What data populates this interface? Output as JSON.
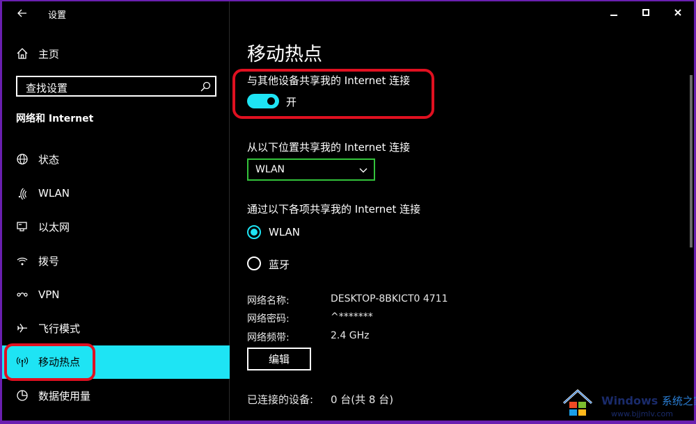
{
  "titlebar": {
    "app_title": "设置"
  },
  "sidebar": {
    "home_label": "主页",
    "search_placeholder": "查找设置",
    "section_title": "网络和 Internet",
    "items": [
      {
        "label": "状态",
        "icon": "globe-icon"
      },
      {
        "label": "WLAN",
        "icon": "wifi-icon"
      },
      {
        "label": "以太网",
        "icon": "ethernet-icon"
      },
      {
        "label": "拨号",
        "icon": "dialup-icon"
      },
      {
        "label": "VPN",
        "icon": "vpn-icon"
      },
      {
        "label": "飞行模式",
        "icon": "airplane-icon"
      },
      {
        "label": "移动热点",
        "icon": "hotspot-icon",
        "selected": true
      },
      {
        "label": "数据使用量",
        "icon": "data-usage-icon"
      }
    ]
  },
  "main": {
    "page_title": "移动热点",
    "share_label": "与其他设备共享我的 Internet 连接",
    "toggle_state": "开",
    "toggle_on": true,
    "from_label": "从以下位置共享我的 Internet 连接",
    "from_selected": "WLAN",
    "via_label": "通过以下各项共享我的 Internet 连接",
    "via_options": [
      {
        "label": "WLAN",
        "checked": true
      },
      {
        "label": "蓝牙",
        "checked": false
      }
    ],
    "info": [
      {
        "key": "网络名称:",
        "value": "DESKTOP-8BKICT0 4711"
      },
      {
        "key": "网络密码:",
        "value": "^*******"
      },
      {
        "key": "网络频带:",
        "value": "2.4 GHz"
      }
    ],
    "edit_label": "编辑",
    "connected_key": "已连接的设备:",
    "connected_value": "0 台(共 8 台)"
  },
  "watermark": {
    "brand": "Windows",
    "brand_cn": "系统之家",
    "url": "www.bjjmlv.com"
  },
  "colors": {
    "accent": "#1ee4f4",
    "highlight": "#e01020",
    "select_border": "#33c33b",
    "frame": "#6a1fb0"
  }
}
